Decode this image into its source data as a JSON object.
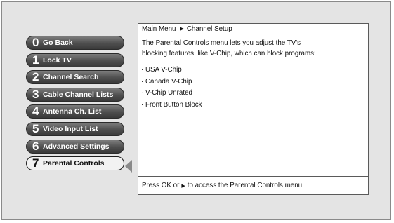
{
  "breadcrumb": {
    "root": "Main Menu",
    "separator_icon": "right-triangle-icon",
    "current": "Channel Setup"
  },
  "description_line1": "The Parental Controls menu lets you adjust the TV's",
  "description_line2": "blocking features, like V-Chip, which can block programs:",
  "items": [
    {
      "label": "· USA V-Chip"
    },
    {
      "label": "· Canada V-Chip"
    },
    {
      "label": "· V-Chip Unrated"
    },
    {
      "label": "· Front Button Block"
    }
  ],
  "menu": [
    {
      "number": "0",
      "label": "Go Back"
    },
    {
      "number": "1",
      "label": "Lock TV"
    },
    {
      "number": "2",
      "label": "Channel Search"
    },
    {
      "number": "3",
      "label": "Cable Channel Lists"
    },
    {
      "number": "4",
      "label": "Antenna Ch. List"
    },
    {
      "number": "5",
      "label": "Video Input List"
    },
    {
      "number": "6",
      "label": "Advanced Settings"
    },
    {
      "number": "7",
      "label": "Parental Controls",
      "selected": true
    }
  ],
  "footer": {
    "before": "Press OK or",
    "arrow_icon": "right-triangle-icon",
    "after": "to access the Parental Controls menu."
  },
  "colors": {
    "background": "#e4e4e4",
    "button": "#4e4e4e",
    "selected_button": "#f2f2f2",
    "panel": "#ffffff"
  }
}
